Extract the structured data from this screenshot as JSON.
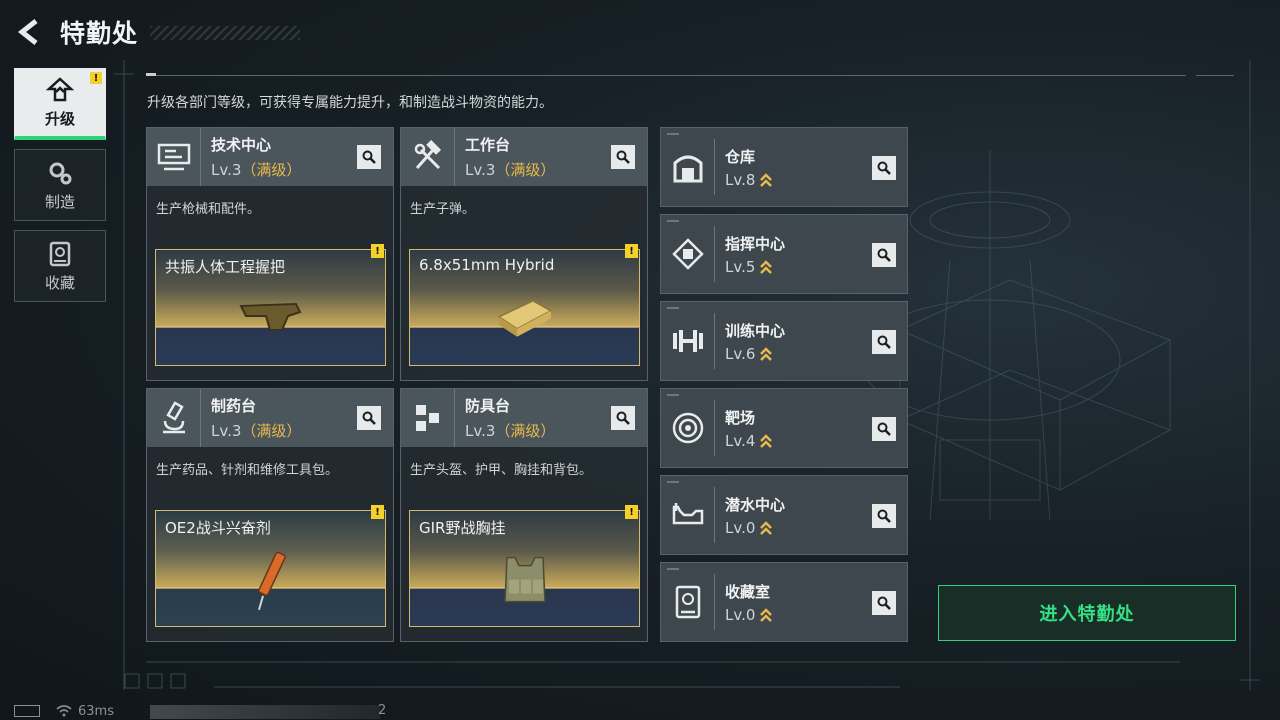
{
  "header": {
    "title": "特勤处"
  },
  "nav": [
    {
      "label": "升级",
      "icon": "upgrade-icon",
      "active": true,
      "alert": "!"
    },
    {
      "label": "制造",
      "icon": "gears-icon",
      "active": false
    },
    {
      "label": "收藏",
      "icon": "collection-icon",
      "active": false
    }
  ],
  "description": "升级各部门等级，可获得专属能力提升，和制造战斗物资的能力。",
  "cards": [
    {
      "name": "技术中心",
      "level": "Lv.3",
      "status": "（满级）",
      "desc": "生产枪械和配件。",
      "item": "共振人体工程握把",
      "icon": "tech-center-icon",
      "item_icon": "grip-icon",
      "alert": "!"
    },
    {
      "name": "工作台",
      "level": "Lv.3",
      "status": "（满级）",
      "desc": "生产子弹。",
      "item": "6.8x51mm Hybrid",
      "icon": "hammer-wrench-icon",
      "item_icon": "ammo-box-icon",
      "alert": "!"
    },
    {
      "name": "制药台",
      "level": "Lv.3",
      "status": "（满级）",
      "desc": "生产药品、针剂和维修工具包。",
      "item": "OE2战斗兴奋剂",
      "icon": "microscope-icon",
      "item_icon": "syringe-icon",
      "alert": "!"
    },
    {
      "name": "防具台",
      "level": "Lv.3",
      "status": "（满级）",
      "desc": "生产头盔、护甲、胸挂和背包。",
      "item": "GIR野战胸挂",
      "icon": "armor-cubes-icon",
      "item_icon": "chest-rig-icon",
      "alert": "!"
    }
  ],
  "facilities": [
    {
      "name": "仓库",
      "level": "Lv.8",
      "icon": "warehouse-icon"
    },
    {
      "name": "指挥中心",
      "level": "Lv.5",
      "icon": "chip-icon"
    },
    {
      "name": "训练中心",
      "level": "Lv.6",
      "icon": "dumbbell-icon"
    },
    {
      "name": "靶场",
      "level": "Lv.4",
      "icon": "target-icon"
    },
    {
      "name": "潜水中心",
      "level": "Lv.0",
      "icon": "diving-mask-icon"
    },
    {
      "name": "收藏室",
      "level": "Lv.0",
      "icon": "collection-room-icon"
    }
  ],
  "enter_button": "进入特勤处",
  "status": {
    "ping": "63ms",
    "num": "2"
  },
  "colors": {
    "accent": "#2fd27a",
    "maxed": "#e8b84a",
    "alert": "#f4d02b"
  }
}
